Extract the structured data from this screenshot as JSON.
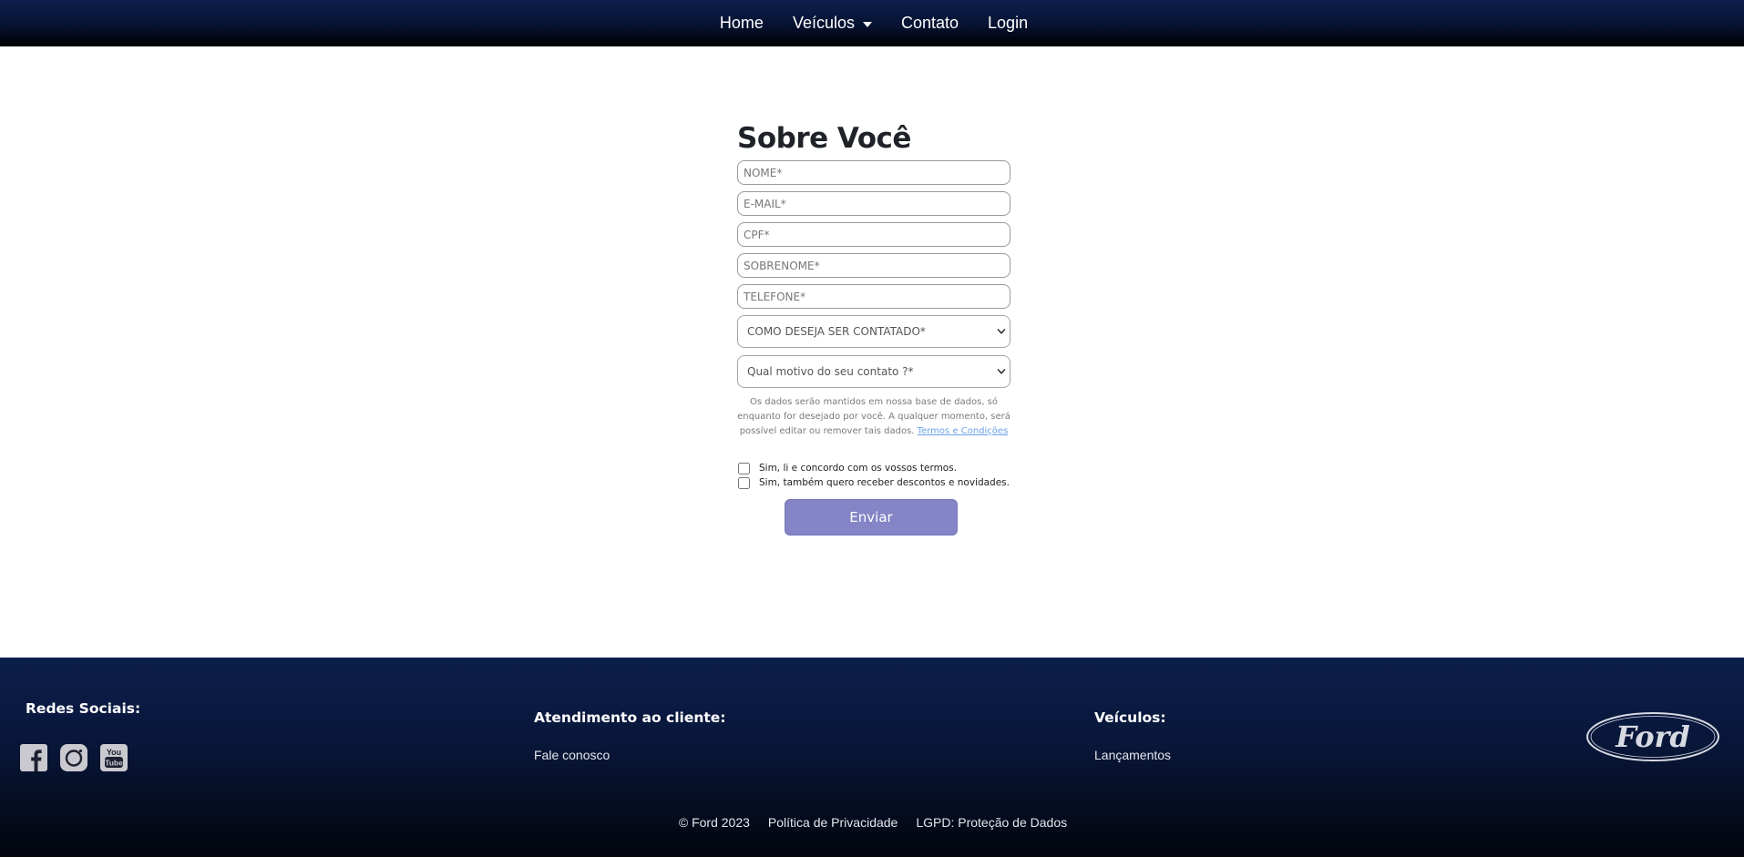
{
  "nav": {
    "items": [
      {
        "label": "Home"
      },
      {
        "label": "Veículos",
        "dropdown": true
      },
      {
        "label": "Contato"
      },
      {
        "label": "Login"
      }
    ]
  },
  "form": {
    "title": "Sobre Você",
    "fields": [
      {
        "placeholder": "NOME*",
        "value": ""
      },
      {
        "placeholder": "E-MAIL*",
        "value": ""
      },
      {
        "placeholder": "CPF*",
        "value": ""
      },
      {
        "placeholder": "SOBRENOME*",
        "value": ""
      },
      {
        "placeholder": "TELEFONE*",
        "value": ""
      }
    ],
    "selects": [
      {
        "selected": "COMO DESEJA SER CONTATADO*"
      },
      {
        "selected": "Qual motivo do seu contato ?*"
      }
    ],
    "disclaimer": "Os dados serão mantidos em nossa base de dados, só enquanto for desejado por você. A qualquer momento, será possível editar ou remover tais dados.",
    "terms_link": "Termos e Condições",
    "checkboxes": [
      {
        "label": "Sim, li e concordo com os vossos termos.",
        "checked": false
      },
      {
        "label": "Sim, também quero receber descontos e novidades.",
        "checked": false
      }
    ],
    "submit_label": "Enviar"
  },
  "footer": {
    "social_heading": "Redes Sociais:",
    "social_icons": [
      "facebook-icon",
      "instagram-icon",
      "youtube-icon"
    ],
    "youtube_text_top": "You",
    "youtube_text_bottom": "Tube",
    "support_heading": "Atendimento ao cliente:",
    "support_link": "Fale conosco",
    "vehicles_heading": "Veículos:",
    "vehicles_link": "Lançamentos",
    "brand_logo_text": "Ford",
    "bottom_links": [
      "© Ford 2023",
      "Política de Privacidade",
      "LGPD: Proteção de Dados"
    ]
  },
  "colors": {
    "navbar_top": "#0d1f4d",
    "navbar_bottom": "#000000",
    "button": "#8484c6",
    "link": "#6aa0e8",
    "footer_top": "#0c1e4c",
    "footer_bottom": "#02050d"
  }
}
